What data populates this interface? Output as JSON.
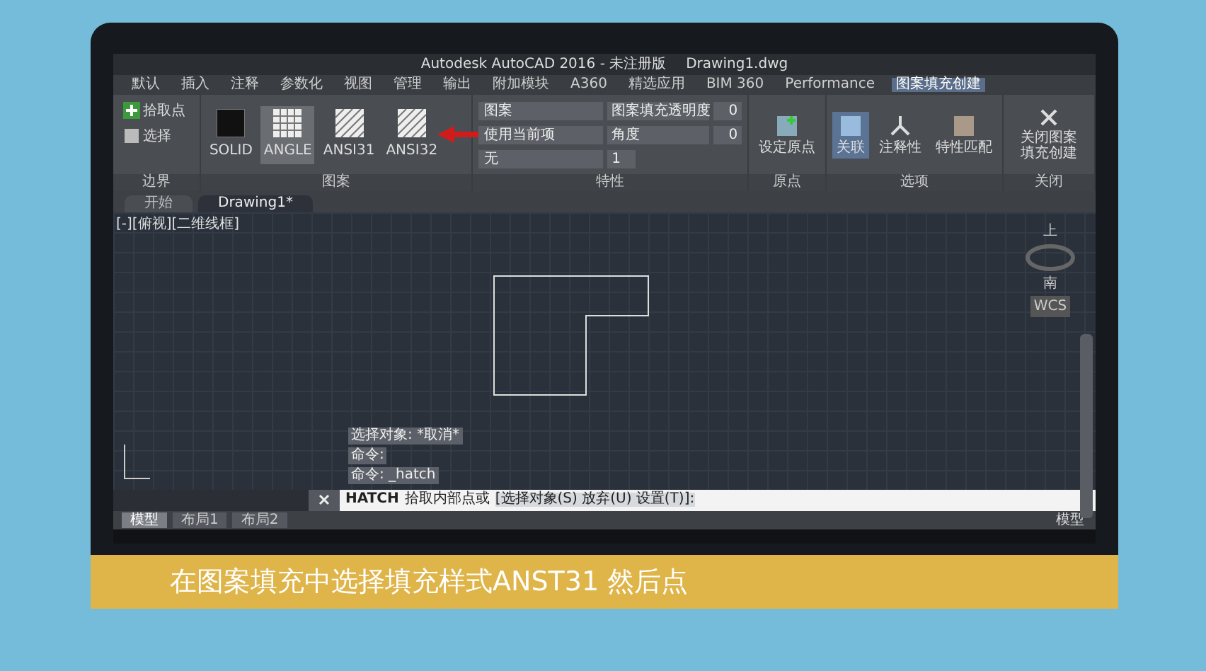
{
  "window": {
    "title": "Autodesk AutoCAD 2016 - 未注册版",
    "file": "Drawing1.dwg"
  },
  "ribbon_tabs": [
    {
      "label": "默认",
      "selected": false
    },
    {
      "label": "插入",
      "selected": false
    },
    {
      "label": "注释",
      "selected": false
    },
    {
      "label": "参数化",
      "selected": false
    },
    {
      "label": "视图",
      "selected": false
    },
    {
      "label": "管理",
      "selected": false
    },
    {
      "label": "输出",
      "selected": false
    },
    {
      "label": "附加模块",
      "selected": false
    },
    {
      "label": "A360",
      "selected": false
    },
    {
      "label": "精选应用",
      "selected": false
    },
    {
      "label": "BIM 360",
      "selected": false
    },
    {
      "label": "Performance",
      "selected": false
    },
    {
      "label": "图案填充创建",
      "selected": true
    }
  ],
  "boundary_panel": {
    "title": "边界",
    "buttons": [
      {
        "label": "拾取点",
        "kind": "pick"
      },
      {
        "label": "选择",
        "kind": "select"
      }
    ]
  },
  "pattern_panel": {
    "title": "图案",
    "patterns": [
      {
        "label": "SOLID",
        "kind": "solid",
        "selected": false
      },
      {
        "label": "ANGLE",
        "kind": "grid",
        "selected": true
      },
      {
        "label": "ANSI31",
        "kind": "hatch",
        "selected": false
      },
      {
        "label": "ANSI32",
        "kind": "hatch",
        "selected": false
      }
    ]
  },
  "properties_panel": {
    "title": "特性",
    "dropdowns": [
      {
        "value": "图案"
      },
      {
        "value": "使用当前项"
      },
      {
        "value": "无"
      }
    ],
    "fields": [
      {
        "label": "图案填充透明度",
        "value": "0"
      },
      {
        "label": "角度",
        "value": "0"
      },
      {
        "value": "1"
      }
    ]
  },
  "origin_panel": {
    "title": "原点",
    "buttons": [
      {
        "label": "设定原点",
        "selected": false
      }
    ]
  },
  "options_panel": {
    "title": "选项",
    "buttons": [
      {
        "label": "关联",
        "selected": true
      },
      {
        "label": "注释性",
        "selected": false
      },
      {
        "label": "特性匹配",
        "selected": false
      }
    ]
  },
  "close_panel": {
    "title": "关闭",
    "buttons": [
      {
        "label": "关闭图案填充创建",
        "selected": false
      }
    ]
  },
  "document_tabs": [
    {
      "label": "开始",
      "selected": false
    },
    {
      "label": "Drawing1*",
      "selected": true
    }
  ],
  "viewport": {
    "label": "[-][俯视][二维线框]"
  },
  "viewcube": {
    "top": "上",
    "bottom": "南",
    "ucs": "WCS"
  },
  "command_history": [
    "选择对象: *取消*",
    "命令:",
    "命令: _hatch"
  ],
  "command_line": {
    "command": "HATCH",
    "prompt": "拾取内部点或",
    "options": "[选择对象(S) 放弃(U) 设置(T)]:"
  },
  "layout_tabs": [
    {
      "label": "模型",
      "selected": true
    },
    {
      "label": "布局1",
      "selected": false
    },
    {
      "label": "布局2",
      "selected": false
    }
  ],
  "status_bar": {
    "mode": "模型"
  },
  "caption": "在图案填充中选择填充样式ANST31 然后点"
}
